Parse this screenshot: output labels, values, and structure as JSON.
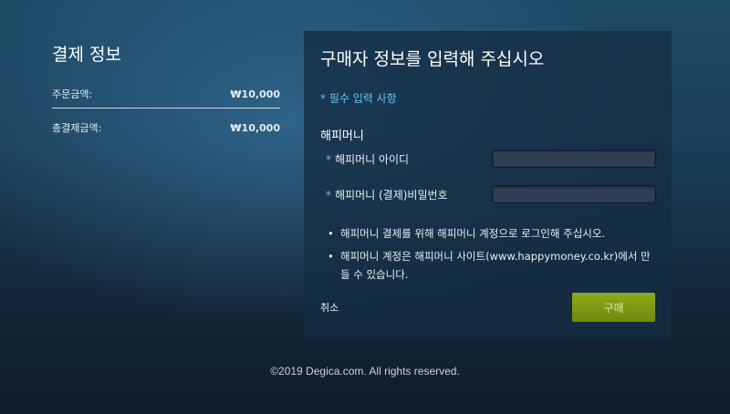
{
  "summary": {
    "title": "결제 정보",
    "order_amount_label": "주문금액:",
    "order_amount_value": "₩10,000",
    "total_label": "총결제금액:",
    "total_value": "₩10,000"
  },
  "form": {
    "title": "구매자 정보를 입력해 주십시오",
    "required_note": "* 필수 입력 사항",
    "section_title": "해피머니",
    "required_star": "*",
    "id_label": "해피머니 아이디",
    "id_value": "",
    "password_label": "해피머니 (결제)비밀번호",
    "password_value": "",
    "bullet": "•",
    "notes": [
      "해피머니 결제를 위해 해피머니 계정으로 로그인해 주십시오.",
      "해피머니 계정은 해피머니 사이트(www.happymoney.co.kr)에서 만들 수 있습니다."
    ],
    "cancel_label": "취소",
    "buy_label": "구매"
  },
  "footer": {
    "copyright": "©2019 Degica.com. All rights reserved."
  },
  "colors": {
    "accent_blue": "#66c0f4",
    "buy_button": "#7d9a14",
    "panel_bg": "#142d42",
    "input_bg": "#2f3d55"
  }
}
